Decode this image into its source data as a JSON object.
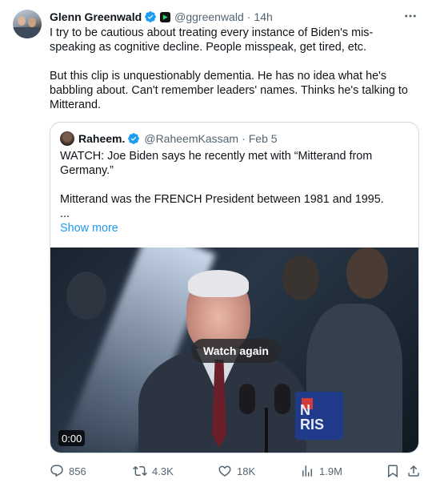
{
  "tweet": {
    "author_name": "Glenn Greenwald",
    "author_handle": "@ggreenwald",
    "time": "14h",
    "paragraph_1": "I try to be cautious about treating every instance of Biden's mis-speaking as cognitive decline. People misspeak, get tired, etc.",
    "paragraph_2": "But this clip is unquestionably dementia. He has no idea what he's babbling about. Can't remember leaders' names. Thinks he's talking to Mitterand."
  },
  "quote": {
    "author_name": "Raheem.",
    "author_handle": "@RaheemKassam",
    "time": "Feb 5",
    "line_1": "WATCH: Joe Biden says he recently met with “Mitterand from Germany.”",
    "line_2": "Mitterand was the FRENCH President between 1981 and 1995.",
    "line_3": "...",
    "show_more": "Show more",
    "video": {
      "watch_again": "Watch again",
      "timestamp": "0:00",
      "sign_text": "N\nRIS"
    }
  },
  "actions": {
    "replies": "856",
    "reposts": "4.3K",
    "likes": "18K",
    "views": "1.9M"
  },
  "colors": {
    "accent": "#1d9bf0",
    "muted": "#536471",
    "border": "#cfd9de"
  }
}
